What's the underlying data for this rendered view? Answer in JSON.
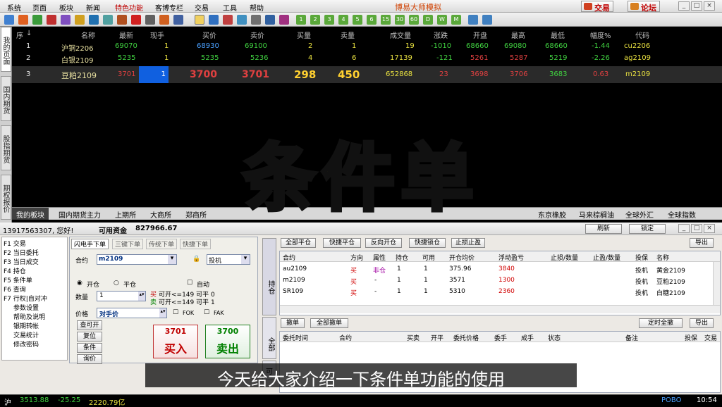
{
  "menu": [
    "系统",
    "页面",
    "板块",
    "新闻",
    "特色功能",
    "客博专栏",
    "交易",
    "工具",
    "帮助"
  ],
  "app_title": "博易大师模拟",
  "top_buttons": {
    "trade": "交易",
    "forum": "论坛"
  },
  "toolbar_numbers": [
    "1",
    "2",
    "3",
    "4",
    "5",
    "6",
    "15",
    "30",
    "60",
    "D",
    "W",
    "M"
  ],
  "left_tabs": [
    "我的页面",
    "国内期货",
    "股指期货",
    "期权报价"
  ],
  "quote_headers": [
    "序",
    "名称",
    "最新",
    "现手",
    "买价",
    "卖价",
    "买量",
    "卖量",
    "成交量",
    "涨跌",
    "开盘",
    "最高",
    "最低",
    "幅度%",
    "代码"
  ],
  "quotes": [
    {
      "seq": "1",
      "name": "沪铜2206",
      "last": "69070",
      "vol": "1",
      "bid": "68930",
      "ask": "69100",
      "bidq": "2",
      "askq": "1",
      "turnover": "19",
      "chg": "-1010",
      "open": "68660",
      "high": "69080",
      "low": "68660",
      "pct": "-1.44",
      "code": "cu2206"
    },
    {
      "seq": "2",
      "name": "白银2109",
      "last": "5235",
      "vol": "1",
      "bid": "5235",
      "ask": "5236",
      "bidq": "4",
      "askq": "6",
      "turnover": "17139",
      "chg": "-121",
      "open": "5261",
      "high": "5287",
      "low": "5219",
      "pct": "-2.26",
      "code": "ag2109"
    },
    {
      "seq": "3",
      "name": "豆粕2109",
      "last": "3701",
      "vol": "1",
      "bid": "3700",
      "ask": "3701",
      "bidq": "298",
      "askq": "450",
      "turnover": "652868",
      "chg": "23",
      "open": "3698",
      "high": "3706",
      "low": "3683",
      "pct": "0.63",
      "code": "m2109"
    }
  ],
  "bottom_tabs": [
    "我的板块",
    "国内期货主力",
    "上期所",
    "大商所",
    "郑商所",
    "东京橡胶",
    "马来棕榈油",
    "全球外汇",
    "全球指数"
  ],
  "account": {
    "user": "13917563307, 您好!",
    "funds_label": "可用资金",
    "funds": "827966.67",
    "refresh": "刷新",
    "lock": "锁定"
  },
  "side_menu": [
    {
      "key": "F1",
      "label": "交易"
    },
    {
      "key": "F2",
      "label": "当日委托"
    },
    {
      "key": "F3",
      "label": "当日成交"
    },
    {
      "key": "F4",
      "label": "持仓"
    },
    {
      "key": "F5",
      "label": "条件单"
    },
    {
      "key": "F6",
      "label": "查询"
    },
    {
      "key": "F7",
      "label": "行权|自对冲"
    },
    {
      "key": "",
      "label": "参数设置"
    },
    {
      "key": "",
      "label": "帮助及说明"
    },
    {
      "key": "",
      "label": "银期转帐"
    },
    {
      "key": "",
      "label": "交易统计"
    },
    {
      "key": "",
      "label": "修改密码"
    }
  ],
  "order_tabs": [
    "闪电手下单",
    "三键下单",
    "传统下单",
    "快捷下单"
  ],
  "order": {
    "contract_label": "合约",
    "contract": "m2109",
    "hedge": "投机",
    "open_label": "开仓",
    "close_label": "平仓",
    "auto_label": "自动",
    "qty_label": "数量",
    "qty": "1",
    "buy_label": "买",
    "sell_label": "卖",
    "buy_info": "可开<=149 可平 0",
    "sell_info": "可开<=149 可平 1",
    "price_label": "价格",
    "price": "对手价",
    "fok": "FOK",
    "fak": "FAK",
    "buy_price": "3701",
    "buy_btn": "买入",
    "sell_price": "3700",
    "sell_btn": "卖出",
    "btns": [
      "查可开",
      "复位",
      "条件",
      "询价"
    ]
  },
  "pos_buttons": [
    "全部平仓",
    "快捷平仓",
    "反向开仓",
    "快捷锁仓",
    "止损止盈"
  ],
  "export": "导出",
  "side_vertical": {
    "pos": "持仓",
    "all": "全部",
    "can": "可"
  },
  "positions_header": [
    "合约",
    "方向",
    "属性",
    "持仓",
    "可用",
    "开仓均价",
    "浮动盈亏",
    "止损/数量",
    "止盈/数量",
    "投保",
    "名称"
  ],
  "positions": [
    {
      "c": "au2109",
      "dir": "买",
      "attr": "非仓",
      "hold": "1",
      "avail": "1",
      "avg": "375.96",
      "pnl": "3840",
      "sl": "",
      "tp": "",
      "hedge": "投机",
      "name": "黄金2109"
    },
    {
      "c": "m2109",
      "dir": "买",
      "attr": "-",
      "hold": "1",
      "avail": "1",
      "avg": "3571",
      "pnl": "1300",
      "sl": "",
      "tp": "",
      "hedge": "投机",
      "name": "豆粕2109"
    },
    {
      "c": "SR109",
      "dir": "买",
      "attr": "-",
      "hold": "1",
      "avail": "1",
      "avg": "5310",
      "pnl": "2360",
      "sl": "",
      "tp": "",
      "hedge": "投机",
      "name": "白糖2109"
    }
  ],
  "order_buttons": [
    "撤单",
    "全部撤单",
    "定时全撤"
  ],
  "orders_header": [
    "委托时间",
    "合约",
    "买卖",
    "开平",
    "委托价格",
    "委手",
    "成手",
    "状态",
    "备注",
    "投保",
    "交易"
  ],
  "big_title": "条件单",
  "caption": "今天给大家介绍一下条件单功能的使用",
  "status": {
    "exchange": "沪",
    "index": "3513.88",
    "chg": "-25.25",
    "amount": "2220.79亿",
    "pobo": "POBO",
    "time": "10:54"
  }
}
